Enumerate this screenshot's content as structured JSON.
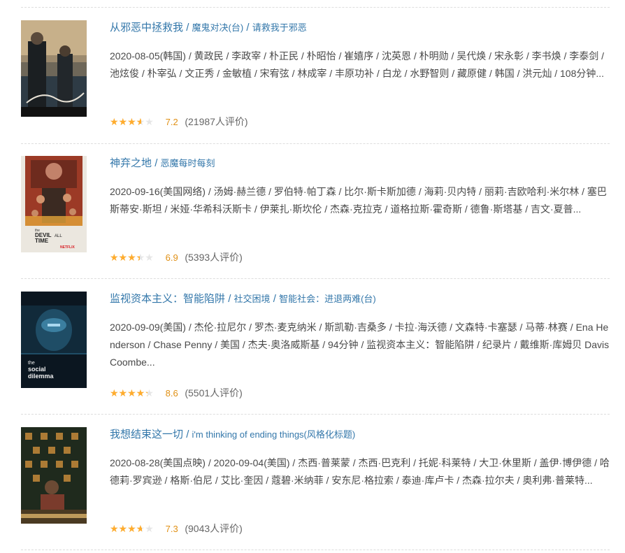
{
  "movies": [
    {
      "title": "从邪恶中拯救我",
      "alt1": "魔鬼对决(台)",
      "alt2": "请救我于邪恶",
      "abstract": "2020-08-05(韩国) / 黄政民 / 李政宰 / 朴正民 / 朴昭怡 / 崔嬉序 / 沈英恩 / 朴明勋 / 吴代焕 / 宋永彰 / 李书焕 / 李泰剑 / 池炫俊 / 朴宰弘 / 文正秀 / 金敏植 / 宋宥弦 / 林成宰 / 丰原功补 / 白龙 / 水野智则 / 藏原健 / 韩国 / 洪元灿 / 108分钟...",
      "score": "7.2",
      "rating_fraction": 0.72,
      "count": "(21987人评价)",
      "poster_colors": [
        "#2b3a44",
        "#c9b089",
        "#1a1a1a"
      ],
      "poster_icon": "poster-action-thriller"
    },
    {
      "title": "神弃之地",
      "alt1": "恶魔每时每刻",
      "alt2": "",
      "abstract": "2020-09-16(美国网络) / 汤姆·赫兰德 / 罗伯特·帕丁森 / 比尔·斯卡斯加德 / 海莉·贝内特 / 丽莉·吉欧哈利·米尔林 / 塞巴斯蒂安·斯坦 / 米娅·华希科沃斯卡 / 伊莱扎·斯坎伦 / 杰森·克拉克 / 道格拉斯·霍奇斯 / 德鲁·斯塔基 / 吉文·夏普...",
      "score": "6.9",
      "rating_fraction": 0.69,
      "count": "(5393人评价)",
      "poster_colors": [
        "#e8e4dc",
        "#b5432c",
        "#3b2a22"
      ],
      "poster_icon": "poster-devil-all-the-time",
      "poster_text": [
        "the",
        "DEVIL",
        "ALL",
        "TIME"
      ],
      "poster_brand": "NETFLIX"
    },
    {
      "title": "监视资本主义：智能陷阱",
      "alt1": "社交困境",
      "alt2": "智能社会：进退两难(台)",
      "abstract": "2020-09-09(美国) / 杰伦·拉尼尔 / 罗杰·麦克纳米 / 斯凯勒·吉桑多 / 卡拉·海沃德 / 文森特·卡塞瑟 / 马蒂·林赛 / Ena Henderson / Chase Penny / 美国 / 杰夫·奥洛威斯基 / 94分钟 / 监视资本主义：智能陷阱 / 纪录片 / 戴维斯·库姆贝 Davis Coombe...",
      "score": "8.6",
      "rating_fraction": 0.86,
      "count": "(5501人评价)",
      "poster_colors": [
        "#0d1b2a",
        "#2a5d7a",
        "#f2f2f2"
      ],
      "poster_icon": "poster-social-dilemma",
      "poster_text": [
        "the",
        "social",
        "dilemma"
      ]
    },
    {
      "title": "我想结束这一切",
      "alt1": "i'm thinking of ending things(风格化标题)",
      "alt2": "",
      "abstract": "2020-08-28(美国点映) / 2020-09-04(美国) / 杰西·普莱蒙 / 杰西·巴克利 / 托妮·科莱特 / 大卫·休里斯 / 盖伊·博伊德 / 哈德莉·罗宾逊 / 格斯·伯尼 / 艾比·奎因 / 蔻碧·米纳菲 / 安东尼·格拉索 / 泰迪·库卢卡 / 杰森·拉尔夫 / 奥利弗·普莱特...",
      "score": "7.3",
      "rating_fraction": 0.73,
      "count": "(9043人评价)",
      "poster_colors": [
        "#1e2a1c",
        "#6b7a3a",
        "#c58a3a"
      ],
      "poster_icon": "poster-ending-things"
    }
  ],
  "separator": "/",
  "stars_glyphs": "★★★★★"
}
